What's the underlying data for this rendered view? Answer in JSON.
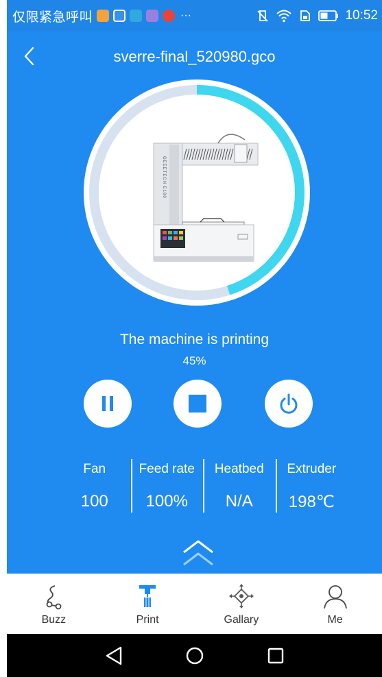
{
  "status_bar": {
    "carrier_text": "仅限紧急呼叫",
    "time": "10:52",
    "notification_icons": [
      "app-icon-orange",
      "app-icon-blue",
      "app-icon-cyan",
      "app-icon-purple",
      "app-icon-red"
    ],
    "overflow": "···"
  },
  "header": {
    "title": "sverre-final_520980.gco"
  },
  "printer": {
    "status": "The machine is printing",
    "progress_label": "45%",
    "progress_fraction": 0.45,
    "brand_text": "GEEETECH E180"
  },
  "controls": [
    "pause",
    "stop",
    "power"
  ],
  "stats": [
    {
      "label": "Fan",
      "value": "100"
    },
    {
      "label": "Feed rate",
      "value": "100%"
    },
    {
      "label": "Heatbed",
      "value": "N/A"
    },
    {
      "label": "Extruder",
      "value": "198℃"
    }
  ],
  "tabs": [
    {
      "label": "Buzz",
      "icon": "buzz-icon"
    },
    {
      "label": "Print",
      "icon": "print-icon",
      "active": true
    },
    {
      "label": "Gallary",
      "icon": "gallary-icon"
    },
    {
      "label": "Me",
      "icon": "me-icon"
    }
  ],
  "colors": {
    "primary": "#1f8af0",
    "progress": "#3fd6f0",
    "track": "#d6e2f0",
    "tab_active": "#1f8af0"
  }
}
